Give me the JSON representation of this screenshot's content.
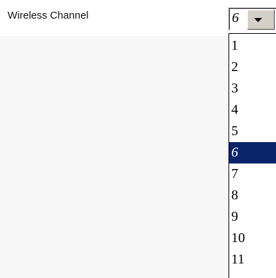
{
  "setting": {
    "label": "Wireless Channel",
    "selected_value": "6"
  },
  "dropdown": {
    "options": [
      "1",
      "2",
      "3",
      "4",
      "5",
      "6",
      "7",
      "8",
      "9",
      "10",
      "11"
    ],
    "selected_index": 5,
    "highlight_color": "#0a246a"
  },
  "icons": {
    "dropdown_arrow": "chevron-down-icon"
  }
}
